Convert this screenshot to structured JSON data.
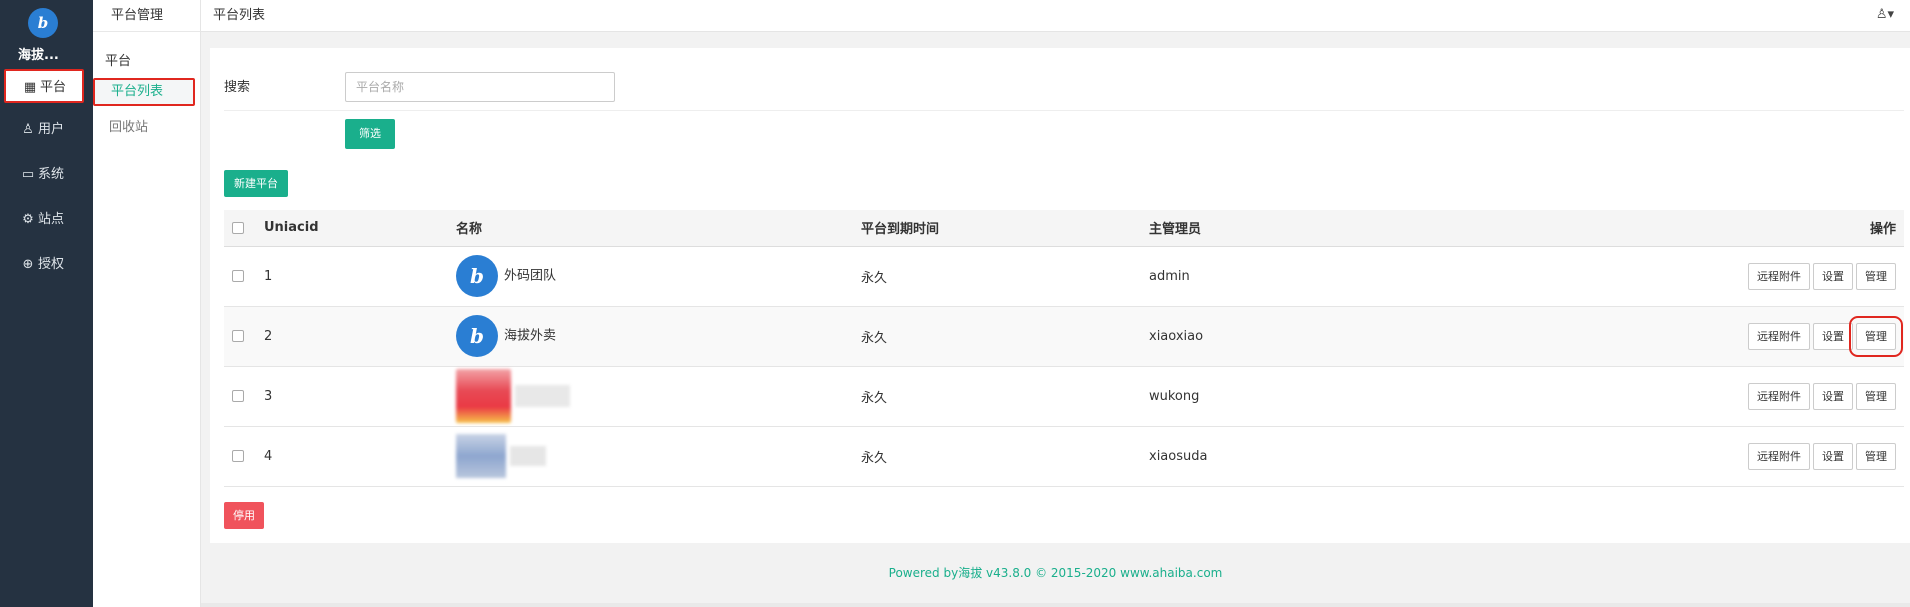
{
  "nav": {
    "logo_text": "b",
    "brand": "海拔...",
    "items": [
      {
        "label": "平台",
        "icon": "grid-icon",
        "glyph": "▦",
        "active": true
      },
      {
        "label": "用户",
        "icon": "user-icon",
        "glyph": "♙",
        "active": false
      },
      {
        "label": "系统",
        "icon": "monitor-icon",
        "glyph": "▭",
        "active": false
      },
      {
        "label": "站点",
        "icon": "gear-icon",
        "glyph": "⚙",
        "active": false
      },
      {
        "label": "授权",
        "icon": "globe-icon",
        "glyph": "⊕",
        "active": false
      }
    ]
  },
  "subnav": {
    "header": "平台管理",
    "group": "平台",
    "items": [
      {
        "label": "平台列表",
        "active": true
      },
      {
        "label": "回收站",
        "active": false
      }
    ]
  },
  "topbar": {
    "title": "平台列表",
    "user_menu": "♙▾"
  },
  "search": {
    "label": "搜索",
    "placeholder": "平台名称",
    "filter_button": "筛选"
  },
  "new_button": "新建平台",
  "table": {
    "headers": [
      "",
      "Uniacid",
      "名称",
      "平台到期时间",
      "主管理员",
      "操作"
    ],
    "rows": [
      {
        "uniacid": "1",
        "name": "外码团队",
        "logo": "b",
        "expire": "永久",
        "admin": "admin"
      },
      {
        "uniacid": "2",
        "name": "海拔外卖",
        "logo": "b",
        "expire": "永久",
        "admin": "xiaoxiao"
      },
      {
        "uniacid": "3",
        "name": "",
        "logo": "",
        "expire": "永久",
        "admin": "wukong"
      },
      {
        "uniacid": "4",
        "name": "",
        "logo": "",
        "expire": "永久",
        "admin": "xiaosuda"
      }
    ],
    "actions": {
      "remote": "远程附件",
      "settings": "设置",
      "manage": "管理"
    }
  },
  "stop_button": "停用",
  "footer": "Powered by海拔 v43.8.0 © 2015-2020 www.ahaiba.com",
  "colors": {
    "accent": "#1aaf8c",
    "danger": "#f0535c",
    "nav_bg": "#253241",
    "highlight": "#e0271f"
  }
}
